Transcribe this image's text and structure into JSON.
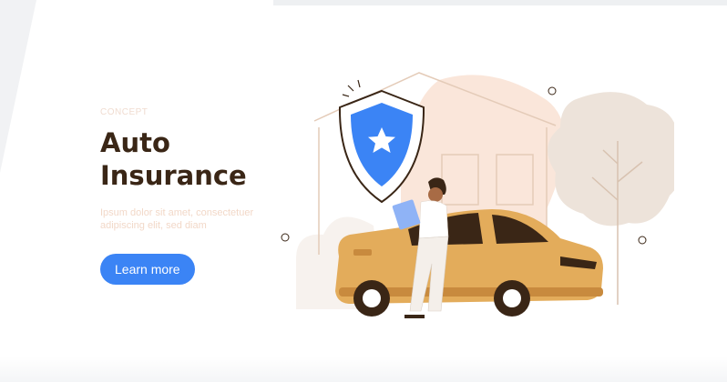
{
  "hero": {
    "eyebrow": "CONCEPT",
    "title_line1": "Auto",
    "title_line2": "Insurance",
    "description": "Ipsum dolor sit amet, consectetuer adipiscing elit, sed diam",
    "cta_label": "Learn more"
  },
  "colors": {
    "accent": "#3b84f5",
    "title": "#3a2616",
    "car": "#e3ac5b",
    "skin_bg": "#fae6da",
    "tree": "#ede3da"
  },
  "illustration": {
    "icons": [
      "shield-icon",
      "star-icon",
      "car",
      "house",
      "tree",
      "person"
    ]
  }
}
